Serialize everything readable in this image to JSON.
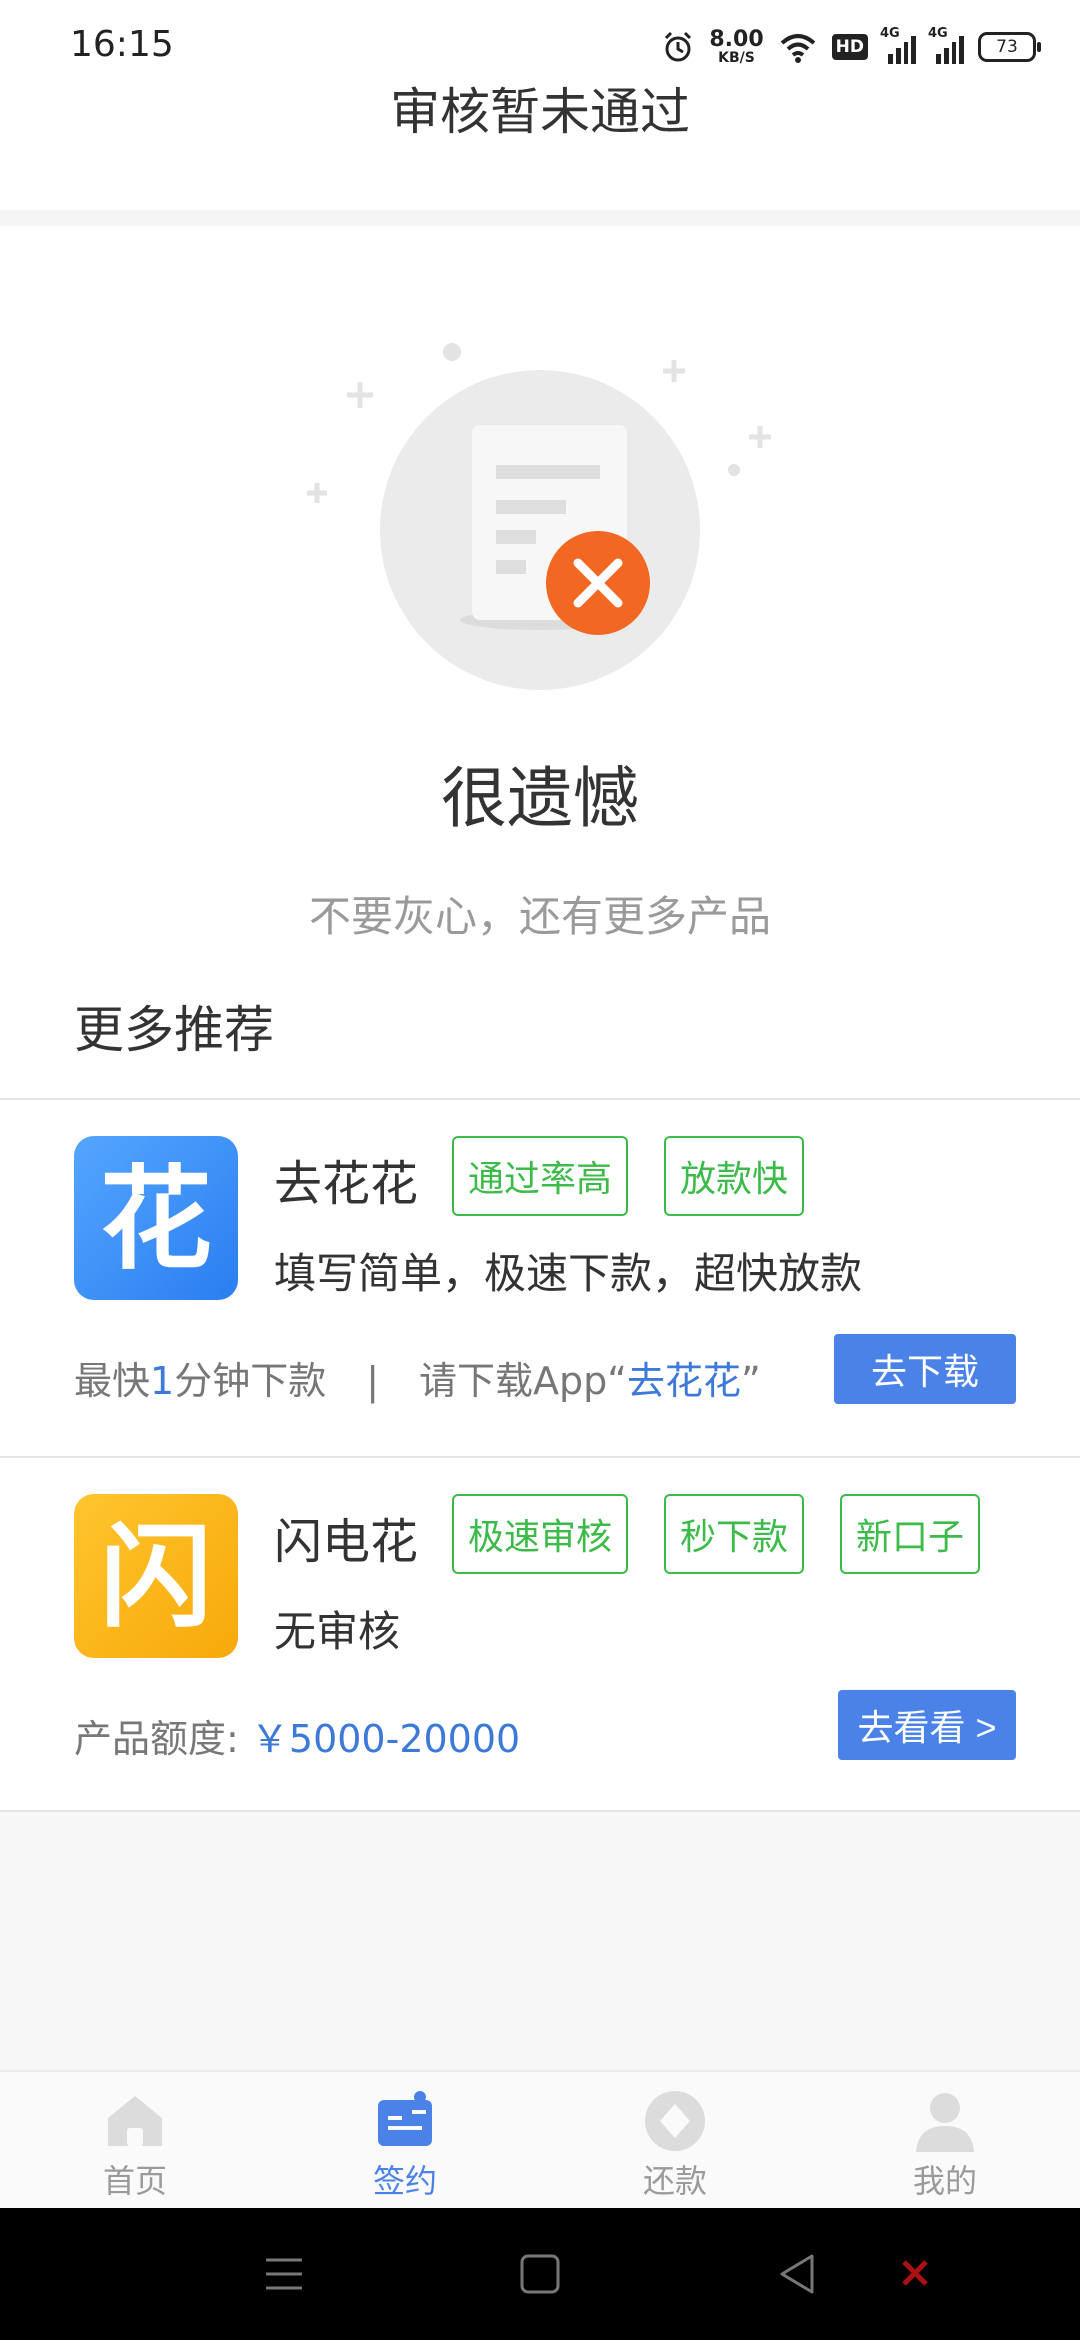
{
  "status_bar": {
    "time": "16:15",
    "net_speed_value": "8.00",
    "net_speed_unit": "KB/S",
    "hd_label": "HD",
    "network_1": "4G",
    "network_2": "4G",
    "battery": "73"
  },
  "header": {
    "title": "审核暂未通过"
  },
  "result": {
    "title": "很遗憾",
    "subtitle": "不要灰心，还有更多产品"
  },
  "section": {
    "title": "更多推荐"
  },
  "products": [
    {
      "logo_char": "花",
      "name": "去花花",
      "tags": [
        "通过率高",
        "放款快"
      ],
      "description": "填写简单，极速下款，超快放款",
      "meta_prefix": "最快",
      "meta_number": "1",
      "meta_suffix": "分钟下款",
      "meta_separator": "|",
      "meta_download_prefix": "请下载App“",
      "meta_download_app": "去花花",
      "meta_download_suffix": "”",
      "button_label": "去下载"
    },
    {
      "logo_char": "闪",
      "name": "闪电花",
      "tags": [
        "极速审核",
        "秒下款",
        "新口子"
      ],
      "description": "无审核",
      "quota_label": "产品额度:",
      "quota_amount": "￥5000-20000",
      "button_label": "去看看 >"
    }
  ],
  "tab_bar": {
    "items": [
      {
        "label": "首页",
        "icon": "home-icon",
        "active": false
      },
      {
        "label": "签约",
        "icon": "contract-icon",
        "active": true
      },
      {
        "label": "还款",
        "icon": "repay-icon",
        "active": false
      },
      {
        "label": "我的",
        "icon": "profile-icon",
        "active": false
      }
    ]
  },
  "colors": {
    "accent": "#4a82e8",
    "tag_green": "#3dbb4a",
    "error_orange": "#f26722",
    "logo_blue": "#3a8cf3",
    "logo_yellow": "#fbb713"
  }
}
